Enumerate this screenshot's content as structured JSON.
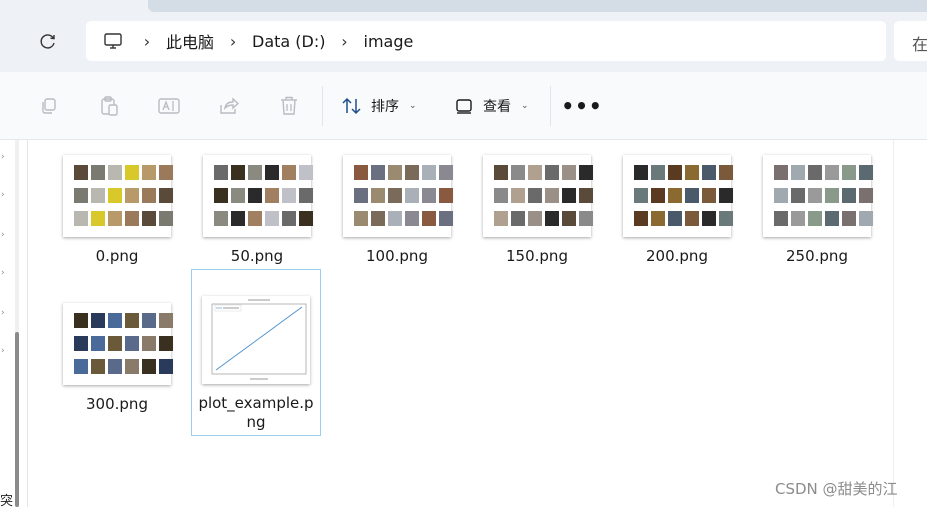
{
  "address": {
    "crumbs": [
      "此电脑",
      "Data (D:)",
      "image"
    ],
    "search_placeholder": "在"
  },
  "toolbar": {
    "sort_label": "排序",
    "view_label": "查看"
  },
  "nav": {
    "cut_text": "突"
  },
  "files": [
    {
      "name": "0.png",
      "palette": [
        "#5a4a3a",
        "#7a7a70",
        "#b8b8b0",
        "#d8c82a",
        "#b89a6a",
        "#9a7a5a"
      ]
    },
    {
      "name": "50.png",
      "palette": [
        "#6a6a6a",
        "#3a3020",
        "#8a8a80",
        "#2a2a2a",
        "#a08060",
        "#c0c0c8"
      ]
    },
    {
      "name": "100.png",
      "palette": [
        "#8a5a40",
        "#6a7080",
        "#9a8a70",
        "#7a6a5a",
        "#aab0b8",
        "#8a8890"
      ]
    },
    {
      "name": "150.png",
      "palette": [
        "#5a4a3a",
        "#8a8a8a",
        "#b0a090",
        "#6a6a6a",
        "#9a9088",
        "#2a2a2a"
      ]
    },
    {
      "name": "200.png",
      "palette": [
        "#2a2a2a",
        "#6a7a7a",
        "#5a3a20",
        "#8a6a30",
        "#4a5a6a",
        "#7a5a3a"
      ]
    },
    {
      "name": "250.png",
      "palette": [
        "#7a7070",
        "#a0a8b0",
        "#6a6a6a",
        "#9a9a9a",
        "#8a9a8a",
        "#5a6a70"
      ]
    },
    {
      "name": "300.png",
      "palette": [
        "#3a3020",
        "#2a3a5a",
        "#4a6a9a",
        "#6a5a3a",
        "#5a6a8a",
        "#8a7a6a"
      ]
    },
    {
      "name": "plot_example.png",
      "selected": true
    }
  ],
  "watermark": "CSDN @甜美的江"
}
